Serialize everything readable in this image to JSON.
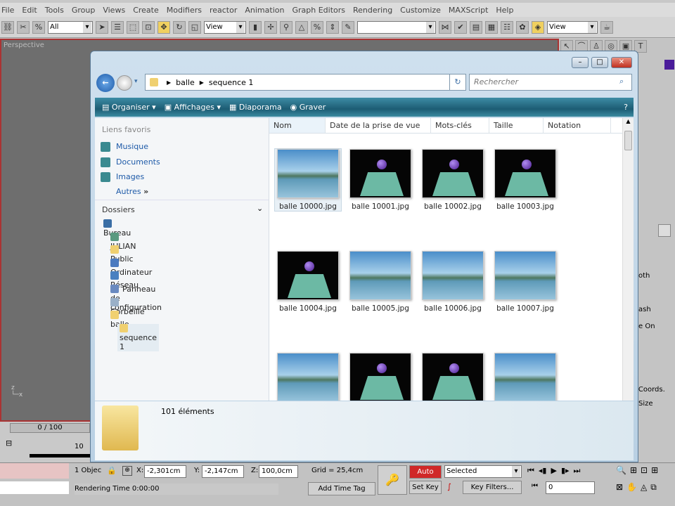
{
  "menu": [
    "File",
    "Edit",
    "Tools",
    "Group",
    "Views",
    "Create",
    "Modifiers",
    "reactor",
    "Animation",
    "Graph Editors",
    "Rendering",
    "Customize",
    "MAXScript",
    "Help"
  ],
  "toolbar": {
    "filter": "All",
    "refcoord": "View",
    "named_sel": "",
    "view2": "View"
  },
  "viewport": {
    "label": "Perspective"
  },
  "timeline": {
    "frame": "0 / 100",
    "tick": "10"
  },
  "status": {
    "objects": "1 Objec",
    "x_label": "X:",
    "x": "-2,301cm",
    "y_label": "Y:",
    "y": "-2,147cm",
    "z_label": "Z:",
    "z": "100,0cm",
    "grid": "Grid = 25,4cm",
    "render_time": "Rendering Time  0:00:00",
    "add_time_tag": "Add Time Tag",
    "auto_key": "Auto Key",
    "set_key": "Set Key",
    "selected": "Selected",
    "key_filters": "Key Filters...",
    "frame_field": "0"
  },
  "cmdpanel": {
    "labels": [
      "oth",
      "ash",
      "e On",
      "ng Coords.",
      "Size"
    ]
  },
  "explorer": {
    "breadcrumb": [
      "balle",
      "sequence 1"
    ],
    "search_placeholder": "Rechercher",
    "commands": [
      "Organiser",
      "Affichages",
      "Diaporama",
      "Graver"
    ],
    "favorites_title": "Liens favoris",
    "favorites": [
      "Musique",
      "Documents",
      "Images",
      "Autres"
    ],
    "folders_title": "Dossiers",
    "tree": [
      {
        "label": "Bureau",
        "level": 0
      },
      {
        "label": "JULIAN",
        "level": 1
      },
      {
        "label": "Public",
        "level": 1
      },
      {
        "label": "Ordinateur",
        "level": 1
      },
      {
        "label": "Réseau",
        "level": 1
      },
      {
        "label": "Panneau de configuration",
        "level": 1
      },
      {
        "label": "Corbeille",
        "level": 1
      },
      {
        "label": "balle",
        "level": 1
      },
      {
        "label": "sequence 1",
        "level": 2
      }
    ],
    "columns": [
      "Nom",
      "Date de la prise de vue",
      "Mots-clés",
      "Taille",
      "Notation"
    ],
    "files": [
      {
        "name": "balle 10000.jpg",
        "kind": "land"
      },
      {
        "name": "balle 10001.jpg",
        "kind": "black"
      },
      {
        "name": "balle 10002.jpg",
        "kind": "black"
      },
      {
        "name": "balle 10003.jpg",
        "kind": "black"
      },
      {
        "name": "balle 10004.jpg",
        "kind": "black"
      },
      {
        "name": "balle 10005.jpg",
        "kind": "land"
      },
      {
        "name": "balle 10006.jpg",
        "kind": "land"
      },
      {
        "name": "balle 10007.jpg",
        "kind": "land"
      },
      {
        "name": "",
        "kind": "land"
      },
      {
        "name": "",
        "kind": "black"
      },
      {
        "name": "",
        "kind": "black"
      },
      {
        "name": "",
        "kind": "land"
      }
    ],
    "count": "101 éléments"
  }
}
